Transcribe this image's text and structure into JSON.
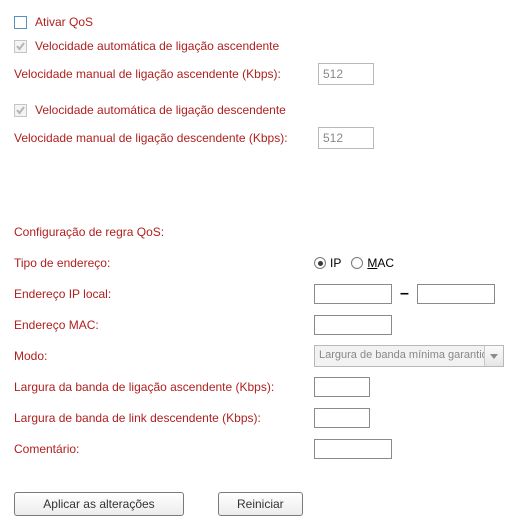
{
  "qos": {
    "activate_label": "Ativar QoS",
    "activate_checked": false,
    "auto_up_label": "Velocidade automática de ligação ascendente",
    "auto_up_checked": true,
    "manual_up_label": "Velocidade manual de ligação ascendente (Kbps):",
    "manual_up_value": "512",
    "auto_down_label": "Velocidade automática de ligação descendente",
    "auto_down_checked": true,
    "manual_down_label": "Velocidade manual de ligação descendente (Kbps):",
    "manual_down_value": "512"
  },
  "rule": {
    "section_title": "Configuração de regra QoS:",
    "addr_type_label": "Tipo de endereço:",
    "radio_ip": "IP",
    "radio_mac": "MAC",
    "radr_selected": "ip",
    "local_ip_label": "Endereço IP local:",
    "mac_label": "Endereço MAC:",
    "mode_label": "Modo:",
    "mode_value": "Largura de banda mínima garantida",
    "up_bw_label": "Largura da banda de ligação ascendente (Kbps):",
    "down_bw_label": "Largura de banda de link descendente (Kbps):",
    "comment_label": "Comentário:"
  },
  "buttons": {
    "apply": "Aplicar as alterações",
    "reset": "Reiniciar"
  }
}
